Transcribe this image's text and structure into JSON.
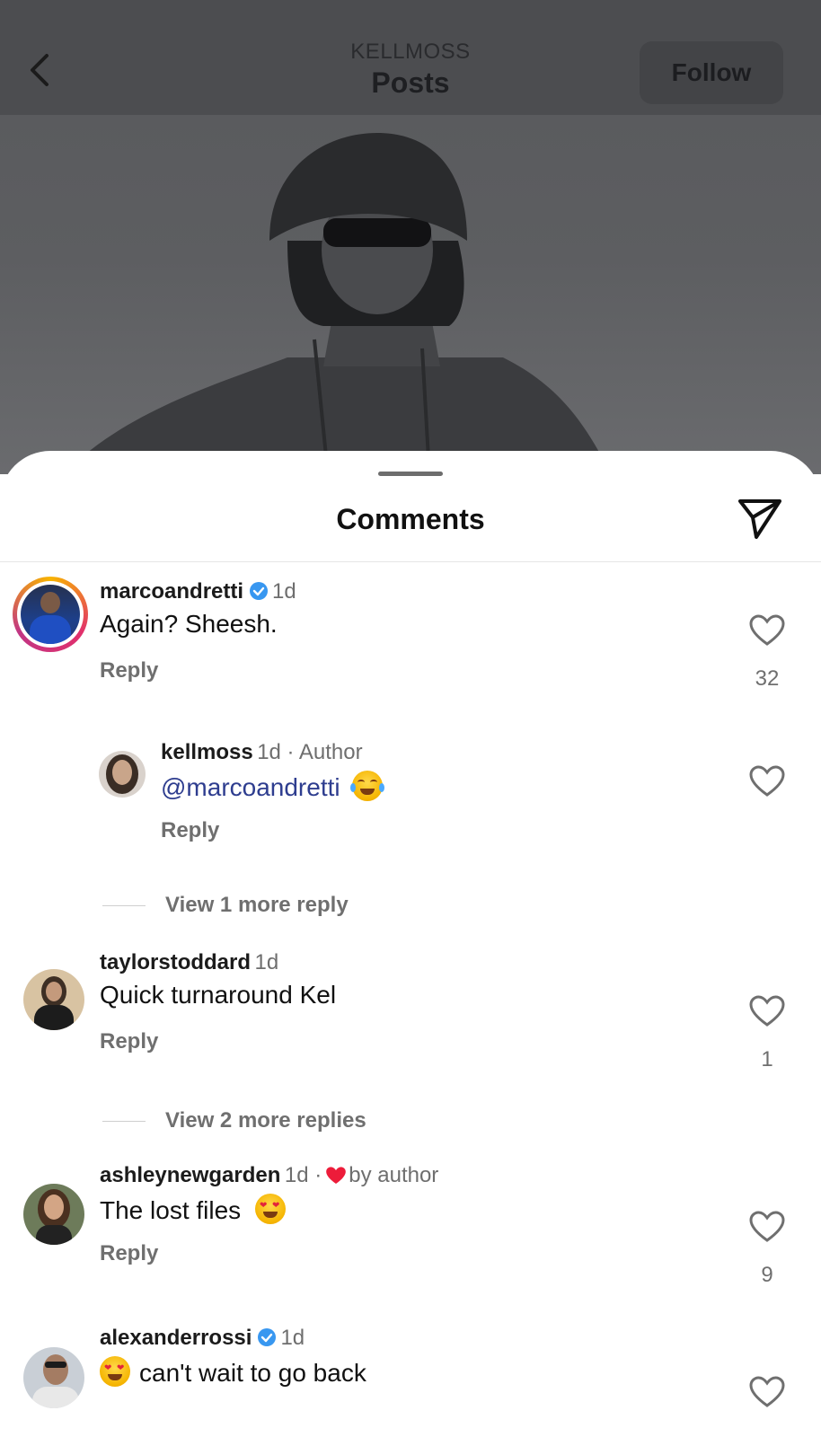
{
  "header": {
    "username": "KELLMOSS",
    "title": "Posts",
    "follow_label": "Follow"
  },
  "sheet": {
    "title": "Comments"
  },
  "comments": [
    {
      "username": "marcoandretti",
      "verified": true,
      "time": "1d",
      "text": "Again? Sheesh.",
      "reply_label": "Reply",
      "likes": "32"
    },
    {
      "username": "kellmoss",
      "time": "1d · Author",
      "mention": "@marcoandretti",
      "emoji": "face-with-tears-of-joy",
      "reply_label": "Reply",
      "view_more": "View 1 more reply"
    },
    {
      "username": "taylorstoddard",
      "time": "1d",
      "text": "Quick turnaround Kel",
      "reply_label": "Reply",
      "likes": "1",
      "view_more": "View 2 more replies"
    },
    {
      "username": "ashleynewgarden",
      "time": "1d ·",
      "liked_by_author": "by author",
      "text": "The lost files",
      "emoji": "smiling-face-with-heart-eyes",
      "reply_label": "Reply",
      "likes": "9"
    },
    {
      "username": "alexanderrossi",
      "verified": true,
      "time": "1d",
      "emoji": "smiling-face-with-heart-eyes",
      "text": "can't wait to go back"
    }
  ],
  "colors": {
    "verified": "#3897f0",
    "heart_red": "#ed1c3a",
    "mention": "#2e3d8f"
  }
}
